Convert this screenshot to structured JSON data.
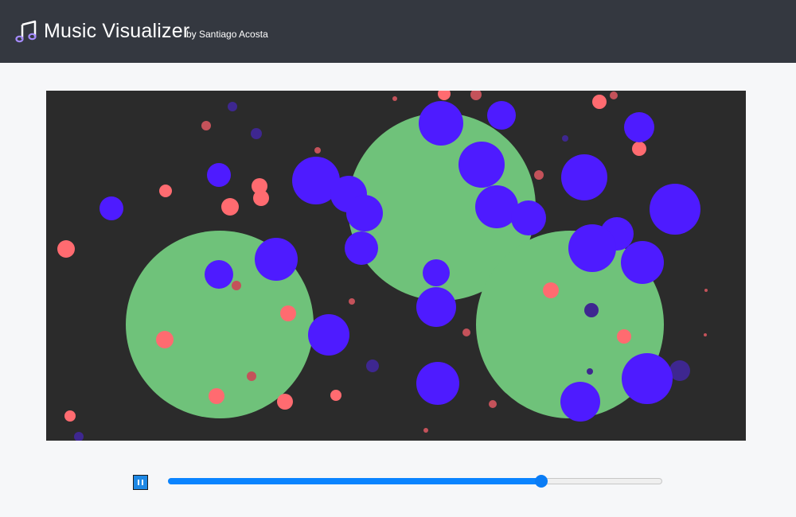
{
  "header": {
    "title": "Music Visualizer",
    "byline": "by Santiago Acosta",
    "icon": "music-note-icon"
  },
  "colors": {
    "header_bg": "#343840",
    "page_bg": "#f6f7f9",
    "canvas_bg": "#2b2b2b",
    "green": "#6fc27a",
    "blue": "#4e1bff",
    "dim_blue": "#3e2790",
    "red": "#ff6b70",
    "dim_red": "#c4525a",
    "accent": "#0a84ff"
  },
  "player": {
    "state": "playing",
    "pause_icon": "pause-icon",
    "progress_fraction": 0.755
  }
}
